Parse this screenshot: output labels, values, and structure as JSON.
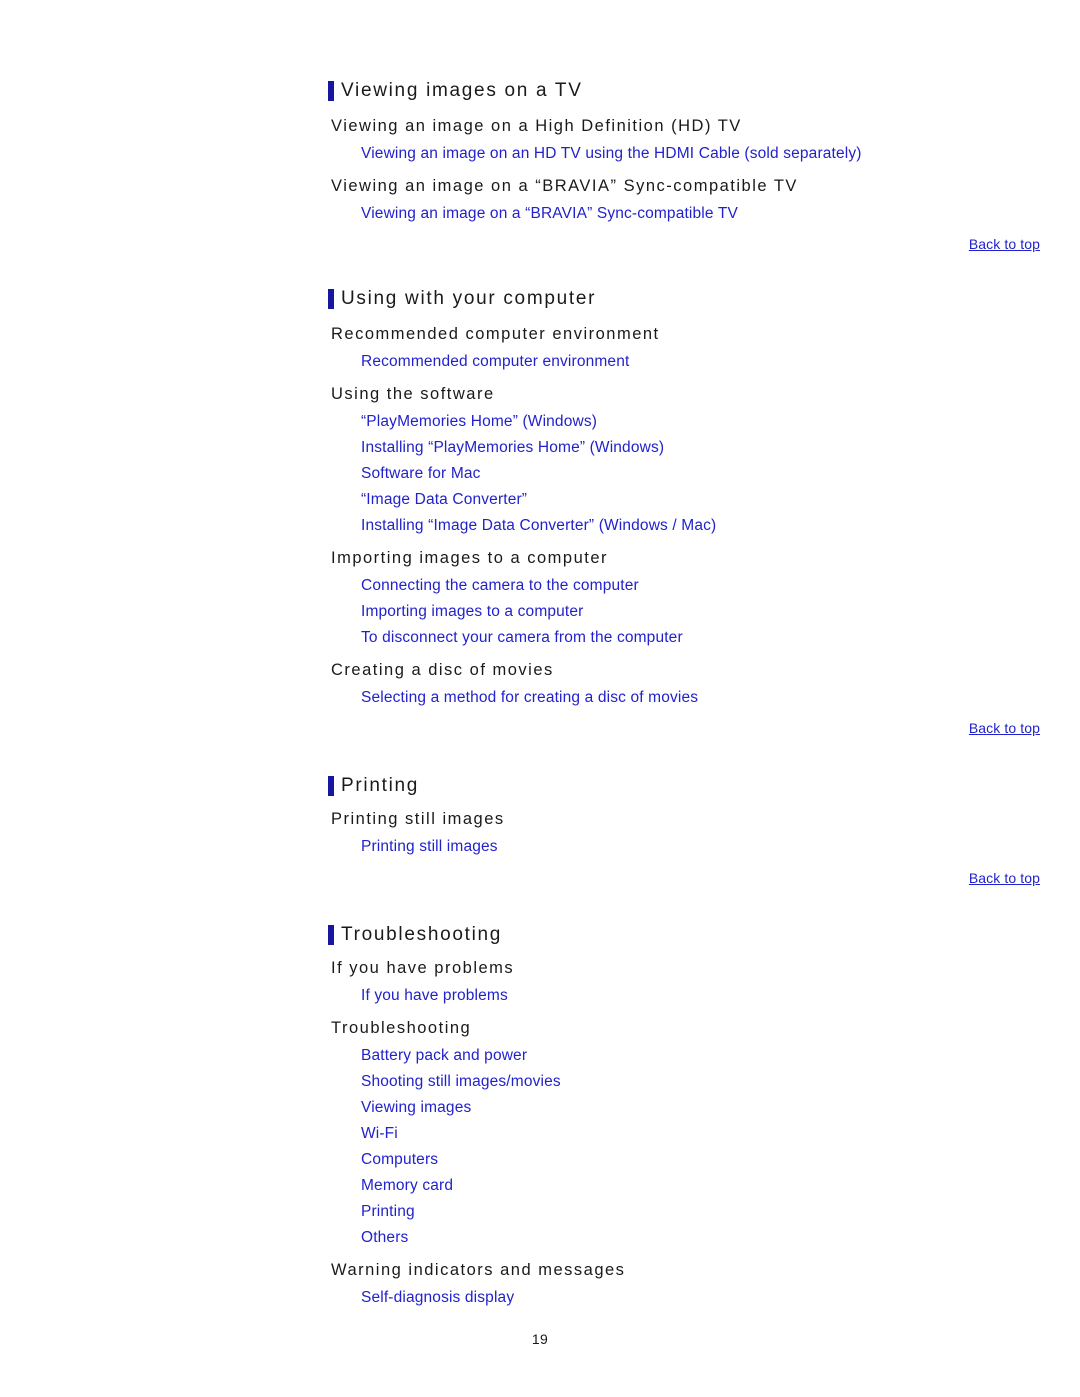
{
  "document": {
    "page_number": "19",
    "link_color": "#2222cc",
    "marker_color": "#16169e",
    "text_color": "#1a1a1a",
    "background": "#ffffff"
  },
  "back_to_top_label": "Back to top",
  "sections": [
    {
      "title": "Viewing images on a TV",
      "groups": [
        {
          "heading": "Viewing an image on a High Definition (HD) TV",
          "links": [
            "Viewing an image on an HD TV using the HDMI Cable (sold separately)"
          ]
        },
        {
          "heading": "Viewing an image on a “BRAVIA” Sync-compatible TV",
          "links": [
            "Viewing an image on a “BRAVIA” Sync-compatible TV"
          ]
        }
      ]
    },
    {
      "title": "Using with your computer",
      "groups": [
        {
          "heading": "Recommended computer environment",
          "links": [
            "Recommended computer environment"
          ]
        },
        {
          "heading": "Using the software",
          "links": [
            "“PlayMemories Home” (Windows)",
            "Installing “PlayMemories Home” (Windows)",
            "Software for Mac",
            "“Image Data Converter”",
            "Installing “Image Data Converter” (Windows / Mac)"
          ]
        },
        {
          "heading": "Importing images to a computer",
          "links": [
            "Connecting the camera to the computer",
            "Importing images to a computer",
            "To disconnect your camera from the computer"
          ]
        },
        {
          "heading": "Creating a disc of movies",
          "links": [
            "Selecting a method for creating a disc of movies"
          ]
        }
      ]
    },
    {
      "title": "Printing",
      "groups": [
        {
          "heading": "Printing still images",
          "links": [
            "Printing still images"
          ]
        }
      ]
    },
    {
      "title": "Troubleshooting",
      "groups": [
        {
          "heading": "If you have problems",
          "links": [
            "If you have problems"
          ]
        },
        {
          "heading": "Troubleshooting",
          "links": [
            "Battery pack and power",
            "Shooting still images/movies",
            "Viewing images",
            "Wi-Fi",
            "Computers",
            "Memory card",
            "Printing",
            "Others"
          ]
        },
        {
          "heading": "Warning indicators and messages",
          "links": [
            "Self-diagnosis display"
          ]
        }
      ]
    }
  ],
  "layout": {
    "section_tops": [
      78,
      286,
      772,
      920
    ],
    "back_to_top_tops": [
      234,
      718,
      868
    ],
    "page_number_top": 1331
  }
}
